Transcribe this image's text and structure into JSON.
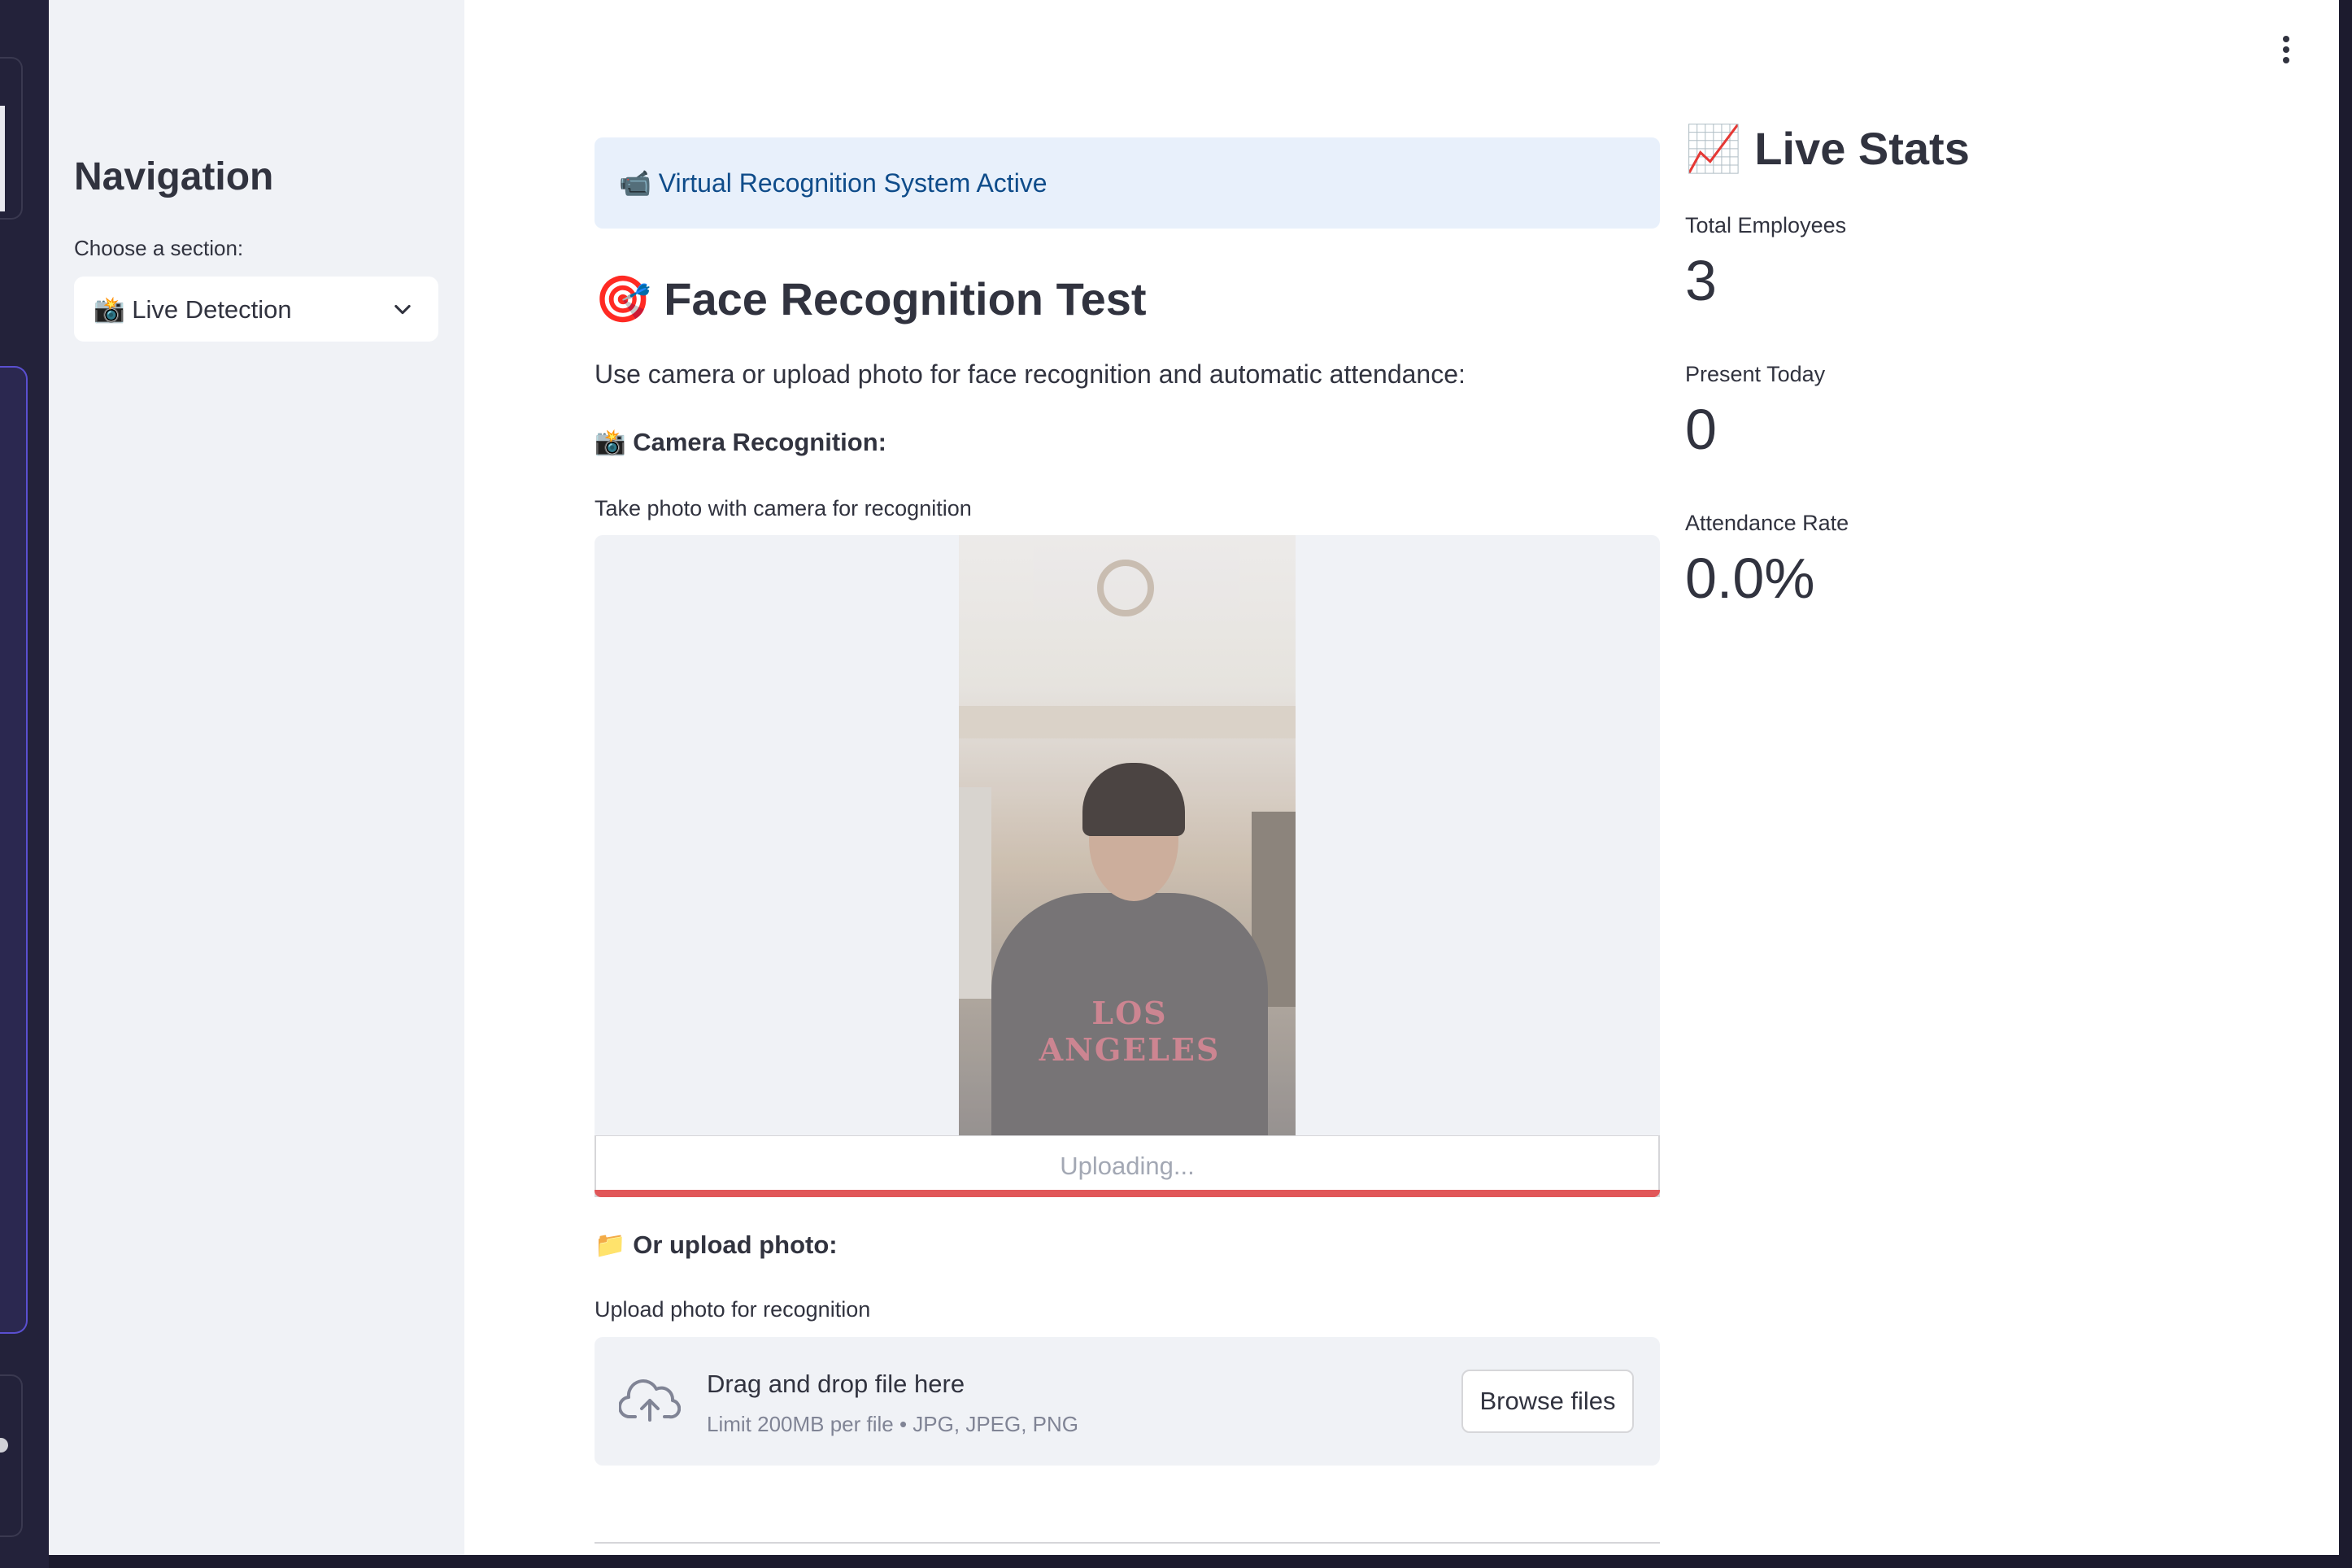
{
  "sidebar": {
    "title": "Navigation",
    "select_label": "Choose a section:",
    "select_value": "📸 Live Detection"
  },
  "main": {
    "info_banner": "📹 Virtual Recognition System Active",
    "title": "🎯 Face Recognition Test",
    "description": "Use camera or upload photo for face recognition and automatic attendance:",
    "camera_heading": "📸 Camera Recognition:",
    "camera_label": "Take photo with camera for recognition",
    "photo_shirt_text": "LOS ANGELES",
    "upload_status": "Uploading...",
    "upload_heading": "📁 Or upload photo:",
    "upload_label": "Upload photo for recognition",
    "dropzone_title": "Drag and drop file here",
    "dropzone_limit": "Limit 200MB per file • JPG, JPEG, PNG",
    "browse_label": "Browse files"
  },
  "stats": {
    "title": "📈 Live Stats",
    "metrics": [
      {
        "label": "Total Employees",
        "value": "3"
      },
      {
        "label": "Present Today",
        "value": "0"
      },
      {
        "label": "Attendance Rate",
        "value": "0.0%"
      }
    ]
  },
  "colors": {
    "sidebar_bg": "#f0f2f6",
    "info_bg": "#e8f0fb",
    "info_text": "#0f4c8a",
    "progress": "#e15759",
    "text": "#31333f"
  },
  "icons": {
    "menu": "kebab-menu-icon",
    "select_chevron": "chevron-down-icon",
    "upload": "cloud-upload-icon"
  }
}
